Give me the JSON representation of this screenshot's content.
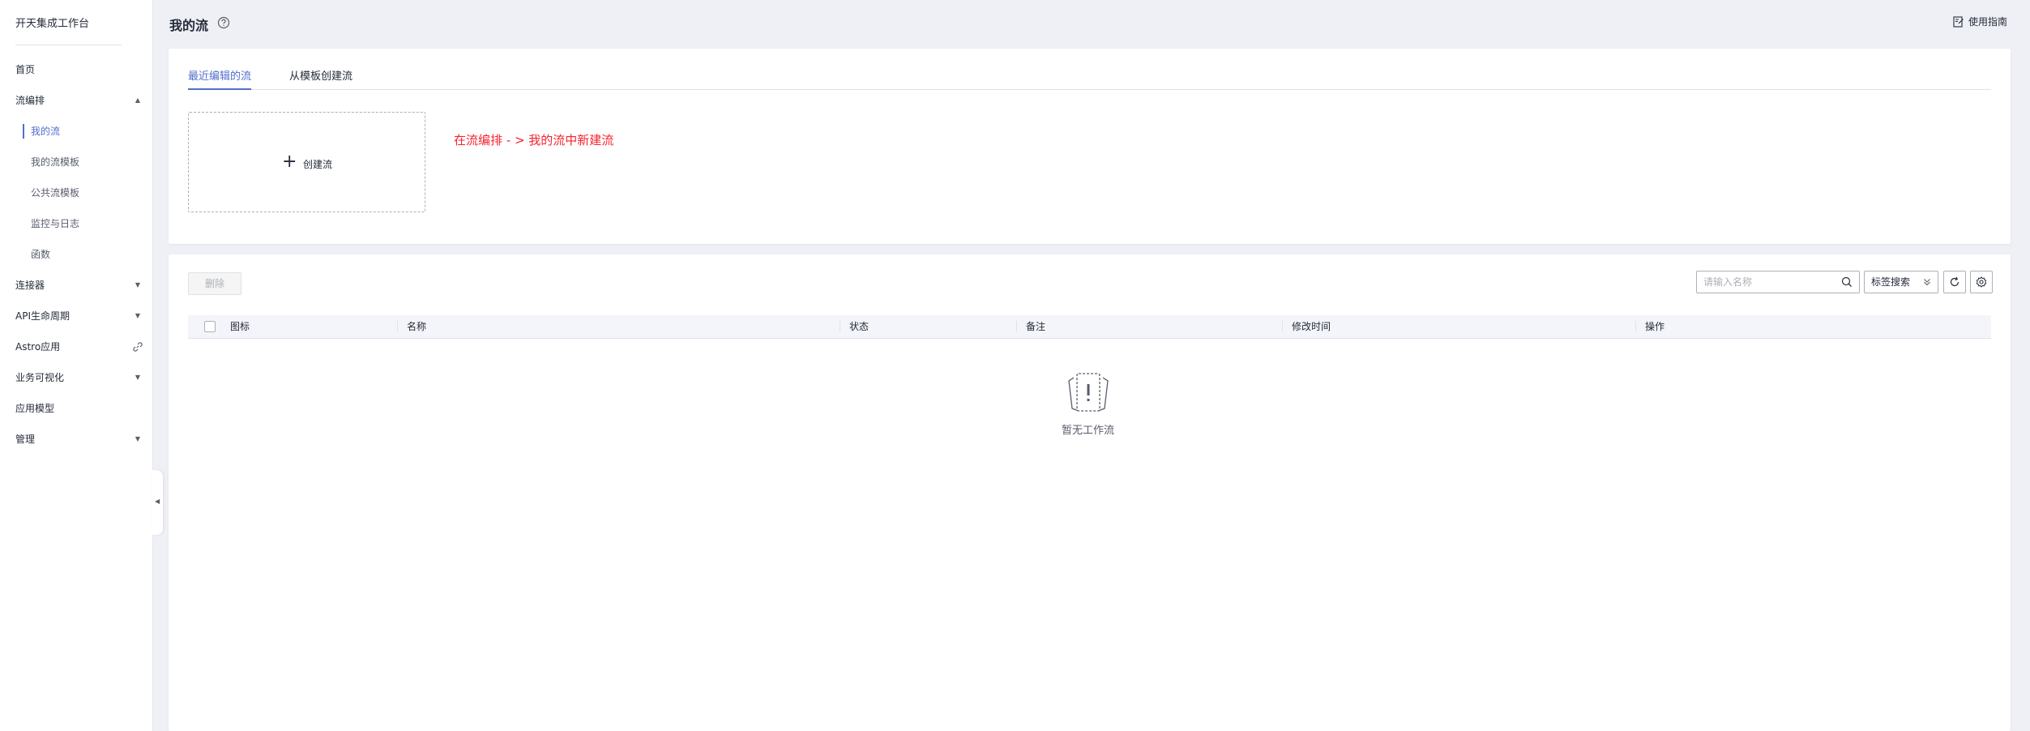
{
  "sidebar": {
    "title": "开天集成工作台",
    "items": [
      {
        "label": "首页"
      },
      {
        "label": "流编排",
        "expanded": true
      },
      {
        "label": "连接器"
      },
      {
        "label": "API生命周期"
      },
      {
        "label": "Astro应用"
      },
      {
        "label": "业务可视化"
      },
      {
        "label": "应用模型"
      },
      {
        "label": "管理"
      }
    ],
    "sub_items": [
      {
        "label": "我的流",
        "active": true
      },
      {
        "label": "我的流模板"
      },
      {
        "label": "公共流模板"
      },
      {
        "label": "监控与日志"
      },
      {
        "label": "函数"
      }
    ]
  },
  "header": {
    "title": "我的流",
    "guide_label": "使用指南"
  },
  "top_card": {
    "tabs": [
      {
        "label": "最近编辑的流",
        "active": true
      },
      {
        "label": "从模板创建流"
      }
    ],
    "create_label": "创建流",
    "hint": "在流编排 - > 我的流中新建流"
  },
  "toolbar": {
    "delete_label": "删除",
    "search_placeholder": "请输入名称",
    "tag_search_label": "标签搜索"
  },
  "table": {
    "columns": [
      "图标",
      "名称",
      "状态",
      "备注",
      "修改时间",
      "操作"
    ],
    "empty_text": "暂无工作流"
  },
  "colors": {
    "accent": "#526ecc",
    "hint": "#f5222d",
    "background": "#eef0f5"
  }
}
